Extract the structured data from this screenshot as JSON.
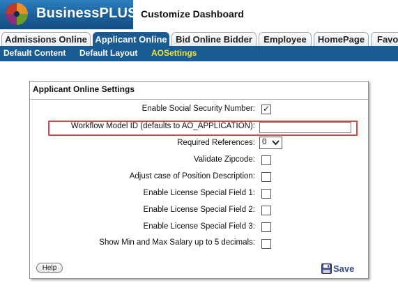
{
  "header": {
    "brand": "BusinessPLUS",
    "page_title": "Customize Dashboard"
  },
  "tabs": [
    {
      "label": "Admissions Online",
      "active": false
    },
    {
      "label": "Applicant Online",
      "active": true
    },
    {
      "label": "Bid Online Bidder",
      "active": false
    },
    {
      "label": "Employee",
      "active": false
    },
    {
      "label": "HomePage",
      "active": false
    },
    {
      "label": "Favo",
      "active": false
    }
  ],
  "subnav": [
    {
      "label": "Default Content",
      "current": false
    },
    {
      "label": "Default Layout",
      "current": false
    },
    {
      "label": "AOSettings",
      "current": true
    }
  ],
  "panel": {
    "title": "Applicant Online Settings",
    "rows": [
      {
        "label": "Enable Social Security Number:",
        "type": "checkbox",
        "checked": true
      },
      {
        "label": "Workflow Model ID (defaults to AO_APPLICATION):",
        "type": "text",
        "value": ""
      },
      {
        "label": "Required References:",
        "type": "select",
        "value": "0"
      },
      {
        "label": "Validate Zipcode:",
        "type": "checkbox",
        "checked": false
      },
      {
        "label": "Adjust case of Position Description:",
        "type": "checkbox",
        "checked": false
      },
      {
        "label": "Enable License Special Field 1:",
        "type": "checkbox",
        "checked": false
      },
      {
        "label": "Enable License Special Field 2:",
        "type": "checkbox",
        "checked": false
      },
      {
        "label": "Enable License Special Field 3:",
        "type": "checkbox",
        "checked": false
      },
      {
        "label": "Show Min and Max Salary up to 5 decimals:",
        "type": "checkbox",
        "checked": false
      }
    ],
    "help_label": "Help",
    "save_label": "Save"
  },
  "colors": {
    "brand_blue": "#1a5b94",
    "current_subnav": "#f1e337",
    "highlight": "#d9463f",
    "save_text": "#3d4c8a"
  },
  "icons": {
    "logo": "businessplus-logo",
    "checkmark": "checkmark-icon",
    "dropdown": "chevron-down-icon",
    "save": "floppy-disk-icon"
  }
}
